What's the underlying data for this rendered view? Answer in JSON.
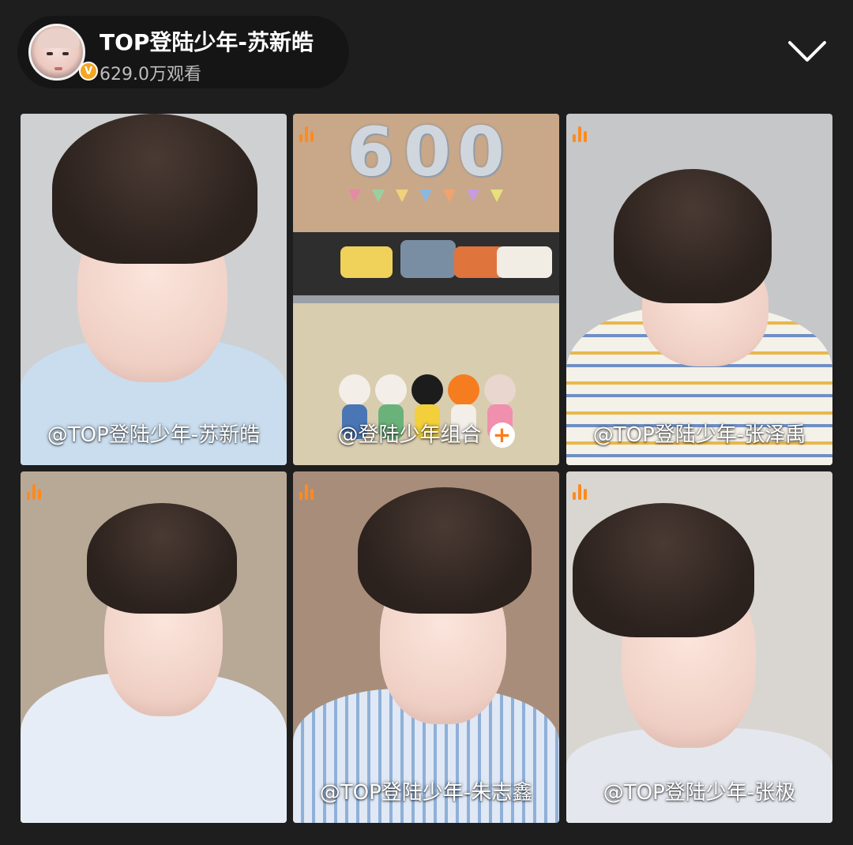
{
  "header": {
    "streamer_name": "TOP登陆少年-苏新皓",
    "viewer_count": "629.0万观看",
    "verified_badge": "V"
  },
  "tiles": [
    {
      "label": "@TOP登陆少年-苏新皓",
      "audio_indicator": false,
      "has_follow_button": false
    },
    {
      "label": "@登陆少年组合",
      "audio_indicator": true,
      "has_follow_button": true,
      "follow_label": "+",
      "balloon_text": [
        "6",
        "0",
        "0"
      ]
    },
    {
      "label": "@TOP登陆少年-张泽禹",
      "audio_indicator": true,
      "has_follow_button": false
    },
    {
      "label": "",
      "audio_indicator": true,
      "has_follow_button": false
    },
    {
      "label": "@TOP登陆少年-朱志鑫",
      "audio_indicator": true,
      "has_follow_button": false
    },
    {
      "label": "@TOP登陆少年-张极",
      "audio_indicator": true,
      "has_follow_button": false
    }
  ],
  "icons": {
    "collapse": "chevron-down-icon",
    "audio": "audio-level-icon",
    "verified": "verified-icon",
    "follow": "plus-icon"
  },
  "colors": {
    "background": "#1e1e1e",
    "accent": "#ff8a1f",
    "verified": "#f5a623"
  }
}
